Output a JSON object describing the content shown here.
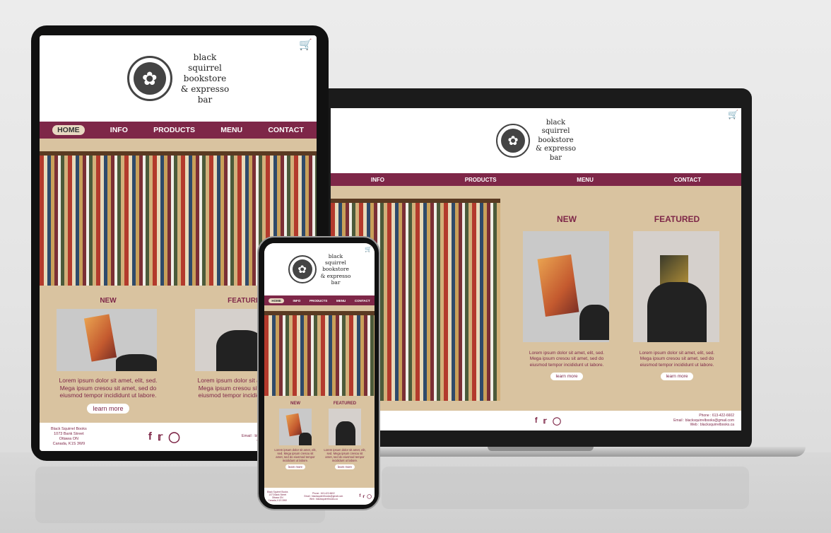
{
  "brand": {
    "line1": "black",
    "line2": "squirrel",
    "line3": "bookstore",
    "line4": "& expresso",
    "line5": "bar"
  },
  "nav": {
    "home": "HOME",
    "info": "INFO",
    "products": "PRODUCTS",
    "menu": "MENU",
    "contact": "CONTACT"
  },
  "sections": {
    "new": "NEW",
    "featured": "FEATURED"
  },
  "lorem": {
    "full": "Lorem ipsum dolor sit amet, elit, sed. Mega ipsum cresou sit amet, sed do eiusmod tempor incididunt ut labore.",
    "laptop": "Lorem ipsum dolor sit amet, elit, sed. Mega ipsum cresou sit amet, sed do eiusmod tempor incididunt ut labore."
  },
  "button": {
    "learn_more": "learn more"
  },
  "footer": {
    "addr1": "Black Squirrel Books",
    "addr2": "1073 Bank Street",
    "addr3": "Ottawa ON",
    "addr4": "Canada, K1S 3W9",
    "phone": "Phone : 613-422-6602",
    "email": "Email : blacksquirrelbooks@gmail.com",
    "web": "Web : blacksquirrelbooks.ca"
  },
  "icons": {
    "cart": "cart-icon",
    "facebook": "facebook-icon",
    "twitter": "twitter-icon",
    "instagram": "instagram-icon",
    "squirrel": "squirrel-logo-icon"
  },
  "colors": {
    "maroon": "#7e2748",
    "tan": "#d9c3a0"
  }
}
